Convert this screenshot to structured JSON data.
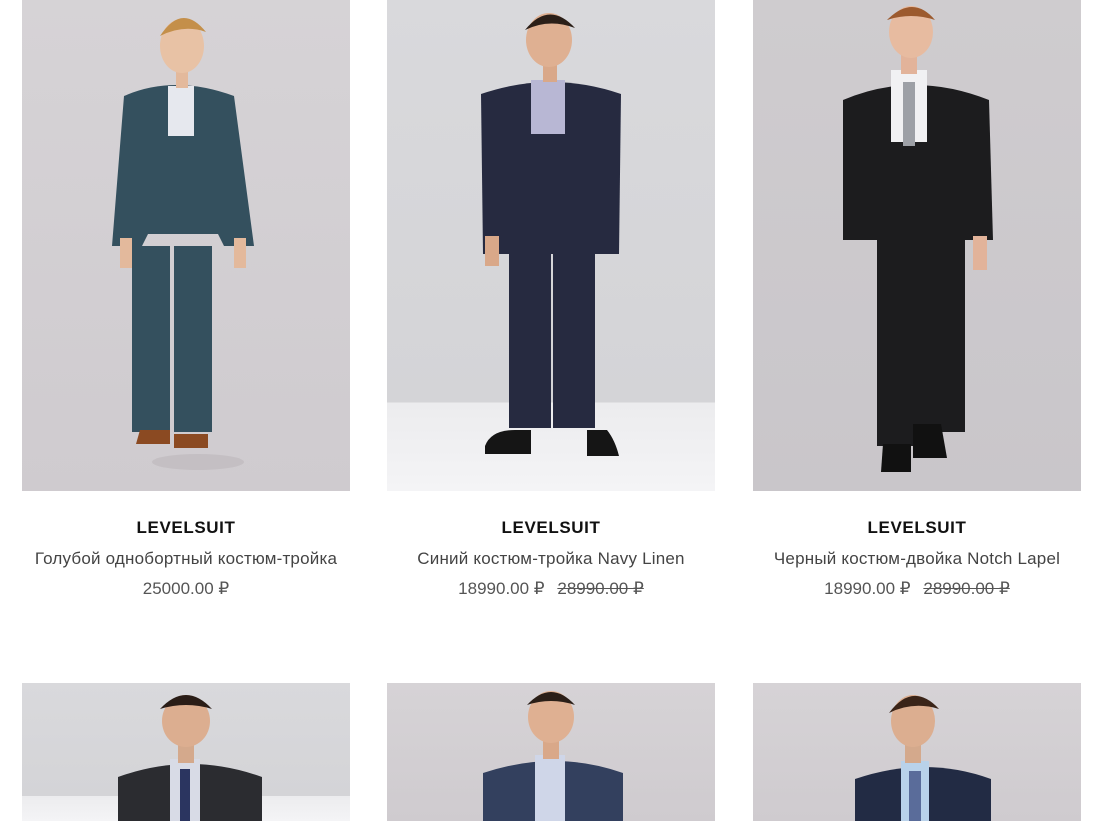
{
  "products": [
    {
      "brand": "LEVELSUIT",
      "title": "Голубой однобортный костюм-тройка",
      "price": "25000.00 ₽",
      "old_price": "",
      "suit_color": "#34505e",
      "shoe_color": "#8b4a22"
    },
    {
      "brand": "LEVELSUIT",
      "title": "Синий костюм-тройка Navy Linen",
      "price": "18990.00 ₽",
      "old_price": "28990.00 ₽",
      "suit_color": "#262a40",
      "shoe_color": "#151515"
    },
    {
      "brand": "LEVELSUIT",
      "title": "Черный костюм-двойка Notch Lapel",
      "price": "18990.00 ₽",
      "old_price": "28990.00 ₽",
      "suit_color": "#1c1c1e",
      "shoe_color": "#111111"
    },
    {
      "brand": "",
      "title": "",
      "price": "",
      "old_price": "",
      "suit_color": "#2b2c30",
      "shoe_color": "#111111"
    },
    {
      "brand": "",
      "title": "",
      "price": "",
      "old_price": "",
      "suit_color": "#33405e",
      "shoe_color": "#111111"
    },
    {
      "brand": "",
      "title": "",
      "price": "",
      "old_price": "",
      "suit_color": "#222b44",
      "shoe_color": "#111111"
    }
  ]
}
